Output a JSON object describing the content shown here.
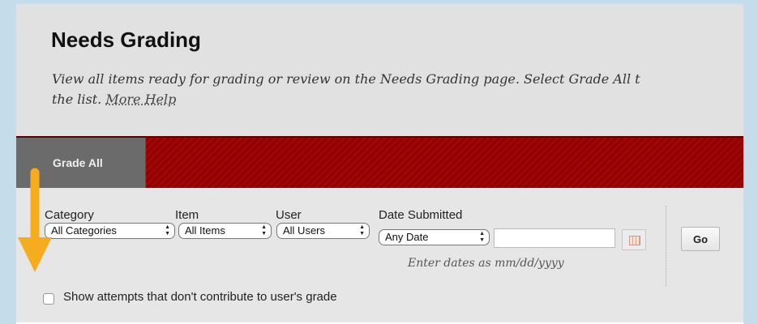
{
  "page": {
    "title": "Needs Grading",
    "description": "View all items ready for grading or review on the Needs Grading page. Select Grade All t",
    "description_line2": "the list.",
    "more_help": "More Help"
  },
  "actionbar": {
    "grade_all": "Grade All"
  },
  "filters": {
    "category": {
      "label": "Category",
      "value": "All Categories"
    },
    "item": {
      "label": "Item",
      "value": "All Items"
    },
    "user": {
      "label": "User",
      "value": "All Users"
    },
    "date": {
      "label": "Date Submitted",
      "value": "Any Date",
      "hint": "Enter dates as mm/dd/yyyy"
    },
    "go": "Go",
    "show_attempts": "Show attempts that don't contribute to user's grade"
  },
  "colors": {
    "background": "#c5dcea",
    "redbar": "#9a0202",
    "tab": "#6b6b6b",
    "annotation_arrow": "#f5ad1d"
  },
  "icons": {
    "select_arrow": "updown-chevron",
    "calendar": "calendar-icon",
    "annotation": "arrow-down-left-icon"
  }
}
